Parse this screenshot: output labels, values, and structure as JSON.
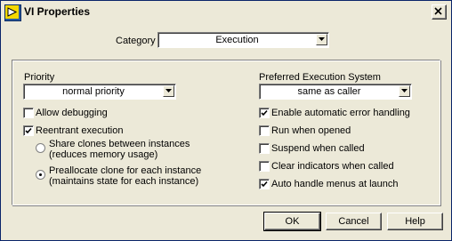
{
  "window": {
    "title": "VI Properties"
  },
  "category": {
    "label": "Category",
    "value": "Execution"
  },
  "priority": {
    "label": "Priority",
    "value": "normal priority"
  },
  "preferred_execution": {
    "label": "Preferred Execution System",
    "value": "same as caller"
  },
  "left_options": {
    "allow_debugging": {
      "label": "Allow debugging",
      "checked": false
    },
    "reentrant": {
      "label": "Reentrant execution",
      "checked": true
    },
    "share_clones": {
      "line1": "Share clones between instances",
      "line2": "(reduces memory usage)",
      "selected": false
    },
    "preallocate": {
      "line1": "Preallocate clone for each instance",
      "line2": "(maintains state for each instance)",
      "selected": true
    }
  },
  "right_options": {
    "enable_error_handling": {
      "label": "Enable automatic error handling",
      "checked": true
    },
    "run_when_opened": {
      "label": "Run when opened",
      "checked": false
    },
    "suspend_when_called": {
      "label": "Suspend when called",
      "checked": false
    },
    "clear_indicators": {
      "label": "Clear indicators when called",
      "checked": false
    },
    "auto_handle_menus": {
      "label": "Auto handle menus at launch",
      "checked": true
    }
  },
  "buttons": {
    "ok": "OK",
    "cancel": "Cancel",
    "help": "Help"
  }
}
